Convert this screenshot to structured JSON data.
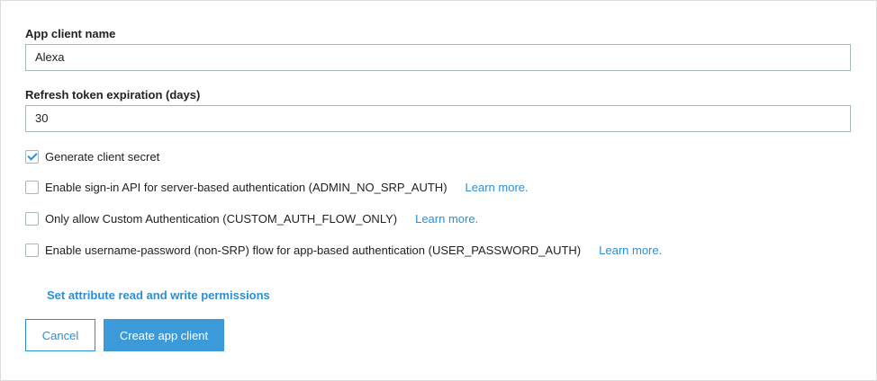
{
  "fields": {
    "app_client_name": {
      "label": "App client name",
      "value": "Alexa"
    },
    "refresh_token": {
      "label": "Refresh token expiration (days)",
      "value": "30"
    }
  },
  "options": [
    {
      "label": "Generate client secret",
      "checked": true,
      "learn_more": ""
    },
    {
      "label": "Enable sign-in API for server-based authentication (ADMIN_NO_SRP_AUTH)",
      "checked": false,
      "learn_more": "Learn more."
    },
    {
      "label": "Only allow Custom Authentication (CUSTOM_AUTH_FLOW_ONLY)",
      "checked": false,
      "learn_more": "Learn more."
    },
    {
      "label": "Enable username-password (non-SRP) flow for app-based authentication (USER_PASSWORD_AUTH)",
      "checked": false,
      "learn_more": "Learn more."
    }
  ],
  "permissions_link": "Set attribute read and write permissions",
  "buttons": {
    "cancel": "Cancel",
    "create": "Create app client"
  }
}
